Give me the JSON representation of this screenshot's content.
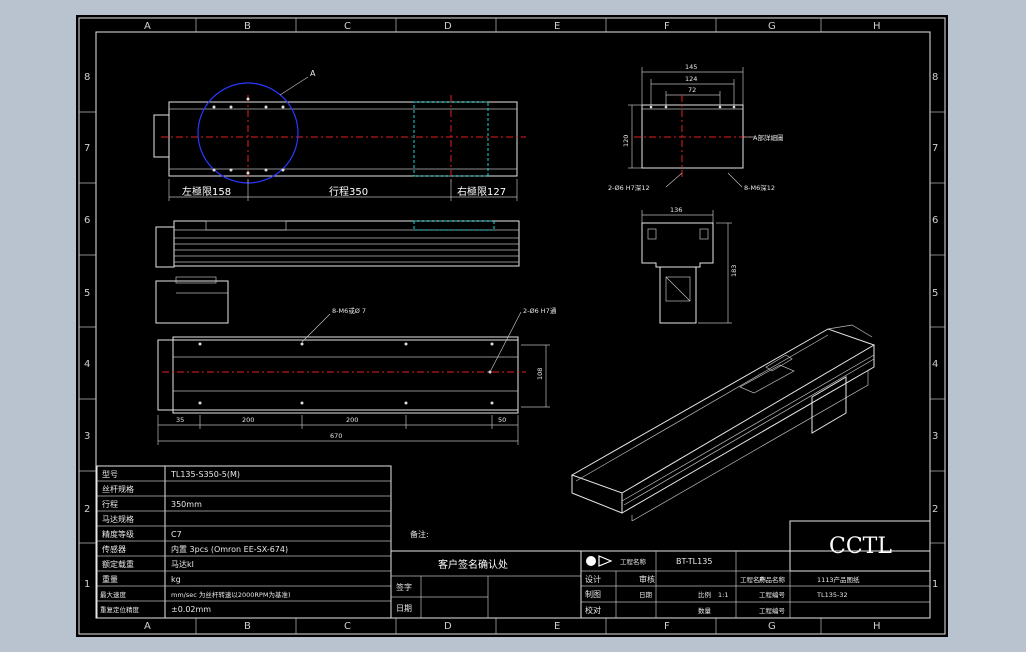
{
  "zones": {
    "columns": [
      "A",
      "B",
      "C",
      "D",
      "E",
      "F",
      "G",
      "H"
    ],
    "rows": [
      "8",
      "7",
      "6",
      "5",
      "4",
      "3",
      "2",
      "1"
    ]
  },
  "views": {
    "top_view": {
      "detail_marker": "A",
      "left_limit": "左極限158",
      "stroke": "行程350",
      "right_limit": "右極限127"
    },
    "bottom_view": {
      "hole_note_left": "8-M6或Ø 7",
      "hole_note_right": "2-Ø6 H7通",
      "dim_width": "108",
      "dim_35": "35",
      "dim_200a": "200",
      "dim_200b": "200",
      "dim_50": "50",
      "dim_total": "670"
    },
    "end_view": {
      "dim_145": "145",
      "dim_124": "124",
      "dim_72": "72",
      "dim_height": "120",
      "detail_label": "A部詳細圖",
      "hole_note_left": "2-Ø6 H7深12",
      "hole_note_right": "8-M6深12"
    },
    "section_view": {
      "dim_136": "136",
      "dim_183": "183"
    }
  },
  "spec_table": {
    "rows": [
      {
        "label": "型号",
        "value": "TL135-S350-5(M)"
      },
      {
        "label": "丝杆规格",
        "value": ""
      },
      {
        "label": "行程",
        "value": "350mm"
      },
      {
        "label": "马达规格",
        "value": ""
      },
      {
        "label": "精度等级",
        "value": "C7"
      },
      {
        "label": "传感器",
        "value": "内置 3pcs (Omron EE-SX-674)"
      },
      {
        "label": "额定载重",
        "value": "马达kl"
      },
      {
        "label": "重量",
        "value": "kg"
      },
      {
        "label": "最大速度",
        "value": "mm/sec  为丝杆转速以2000RPM为基准)"
      },
      {
        "label": "重复定位精度",
        "value": "±0.02mm"
      }
    ]
  },
  "notes_label": "备注:",
  "confirm_block": {
    "title": "客户签名确认处",
    "sign_label": "签字",
    "date_label": "日期"
  },
  "title_block": {
    "company_field": "工程名称",
    "drawing_name": "BT-TL135",
    "row1": [
      "设计",
      "审核",
      "工程名称",
      "产品名称",
      "1113产品图纸"
    ],
    "row2": [
      "制图",
      "日期",
      "比例",
      "1:1",
      "工程编号",
      "TL135-32"
    ],
    "row3": [
      "校对",
      "数量",
      "工程编号"
    ]
  },
  "brand": "CCTL"
}
